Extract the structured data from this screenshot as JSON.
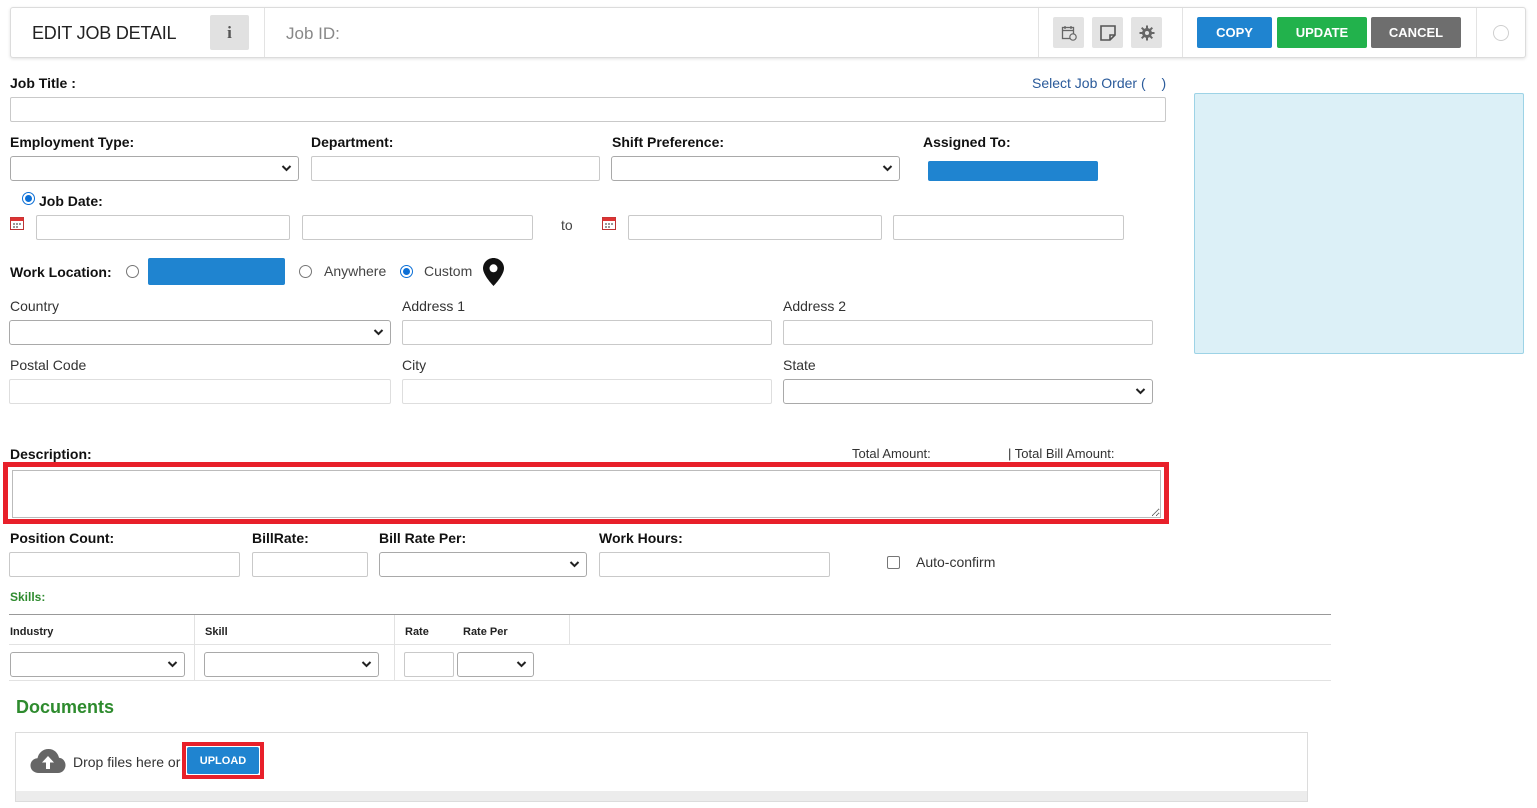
{
  "header": {
    "title": "EDIT JOB DETAIL",
    "info_icon": "info-icon",
    "job_id_label": "Job ID:",
    "copy_label": "COPY",
    "update_label": "UPDATE",
    "cancel_label": "CANCEL",
    "colors": {
      "copy": "#1f84d0",
      "update": "#22b24c",
      "cancel": "#6e6e6e"
    }
  },
  "form": {
    "job_title_label": "Job Title :",
    "select_job_order_link": "Select Job Order (",
    "select_job_order_close": ")",
    "employment_type_label": "Employment Type:",
    "department_label": "Department:",
    "shift_preference_label": "Shift Preference:",
    "assigned_to_label": "Assigned To:",
    "job_date_label": "Job Date:",
    "to_label": "to",
    "work_location_label": "Work Location:",
    "anywhere_label": "Anywhere",
    "custom_label": "Custom",
    "country_label": "Country",
    "address1_label": "Address 1",
    "address2_label": "Address 2",
    "postal_code_label": "Postal Code",
    "city_label": "City",
    "state_label": "State",
    "description_label": "Description:",
    "total_amount_label": "Total Amount:",
    "total_bill_amount_label": "| Total Bill Amount:",
    "position_count_label": "Position Count:",
    "bill_rate_label": "BillRate:",
    "bill_rate_per_label": "Bill Rate Per:",
    "work_hours_label": "Work Hours:",
    "auto_confirm_label": "Auto-confirm"
  },
  "skills": {
    "title": "Skills:",
    "columns": [
      "Industry",
      "Skill",
      "Rate",
      "Rate Per"
    ]
  },
  "documents": {
    "title": "Documents",
    "drop_text": "Drop files here or",
    "upload_label": "UPLOAD"
  }
}
